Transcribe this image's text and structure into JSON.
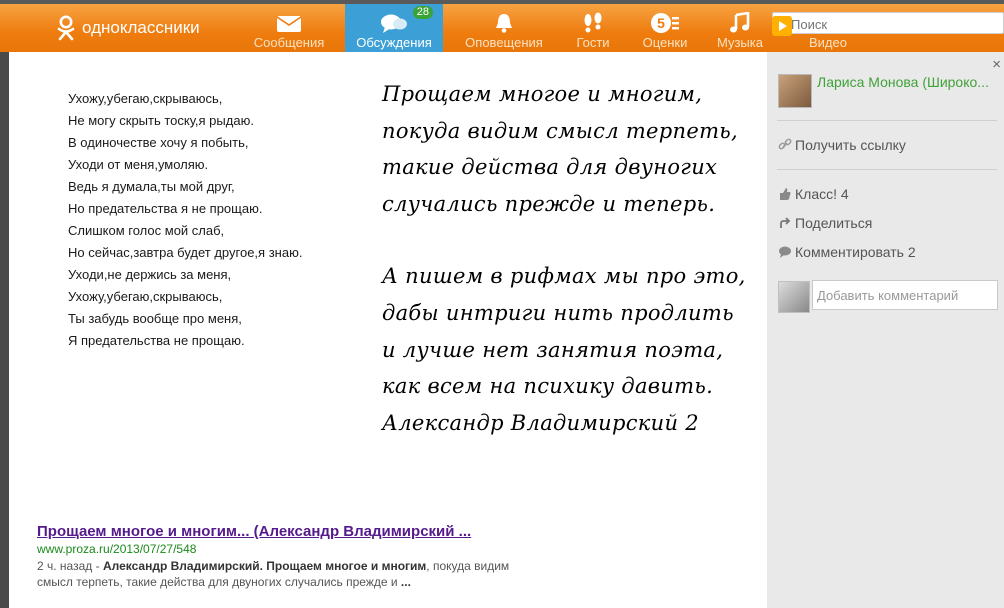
{
  "brand": {
    "name": "одноклассники"
  },
  "nav": [
    {
      "label": "Сообщения",
      "icon": "envelope-icon"
    },
    {
      "label": "Обсуждения",
      "icon": "chat-bubbles-icon",
      "badge": "28",
      "active": true
    },
    {
      "label": "Оповещения",
      "icon": "bell-icon"
    },
    {
      "label": "Гости",
      "icon": "footprints-icon"
    },
    {
      "label": "Оценки",
      "icon": "rating-5-icon"
    },
    {
      "label": "Музыка",
      "icon": "music-note-icon"
    },
    {
      "label": "Видео",
      "icon": "video-icon"
    }
  ],
  "search": {
    "placeholder": "Поиск"
  },
  "photo": {
    "poem_left": [
      "Ухожу,убегаю,скрываюсь,",
      "Не могу скрыть тоску,я рыдаю.",
      "В одиночестве хочу я побыть,",
      "Уходи от меня,умоляю.",
      "Ведь я думала,ты мой друг,",
      "Но предательства я не прощаю.",
      "Слишком голос мой слаб,",
      "Но сейчас,завтра будет другое,я знаю.",
      "Уходи,не держись за меня,",
      "Ухожу,убегаю,скрываюсь,",
      "Ты забудь вообще про меня,",
      "Я предательства не прощаю."
    ],
    "poem_right_1": [
      "Прощаем многое и многим,",
      "покуда видим смысл терпеть,",
      "такие действа для двуногих",
      "случались прежде и теперь."
    ],
    "poem_right_2": [
      "А пишем в рифмах мы про это,",
      "дабы интриги нить продлить",
      "и лучше нет занятия поэта,",
      "как всем на психику давить.",
      "Александр Владимирский 2"
    ],
    "search_result": {
      "title": "Прощаем многое и многим... (Александр Владимирский ...",
      "url": "www.proza.ru/2013/07/27/548",
      "snippet_prefix": "2 ч. назад - ",
      "snippet_bold_1": "Александр Владимирский",
      "snippet_sep": ". ",
      "snippet_bold_2": "Прощаем многое и многим",
      "snippet_rest": ", покуда видим смысл терпеть, такие действа для двуногих случались прежде и ",
      "snippet_end": "..."
    }
  },
  "sidebar": {
    "close_label": "×",
    "user_name": "Лариса Монова (Широко...",
    "get_link": "Получить ссылку",
    "like": "Класс! 4",
    "share": "Поделиться",
    "comment": "Комментировать 2",
    "comment_placeholder": "Добавить комментарий"
  },
  "colors": {
    "topbar": "#ee7c0e",
    "active_tab": "#3ca0d6",
    "badge": "#3aa337",
    "user_link": "#41a23a",
    "result_title": "#551a8b",
    "result_url": "#1a8a1a"
  }
}
